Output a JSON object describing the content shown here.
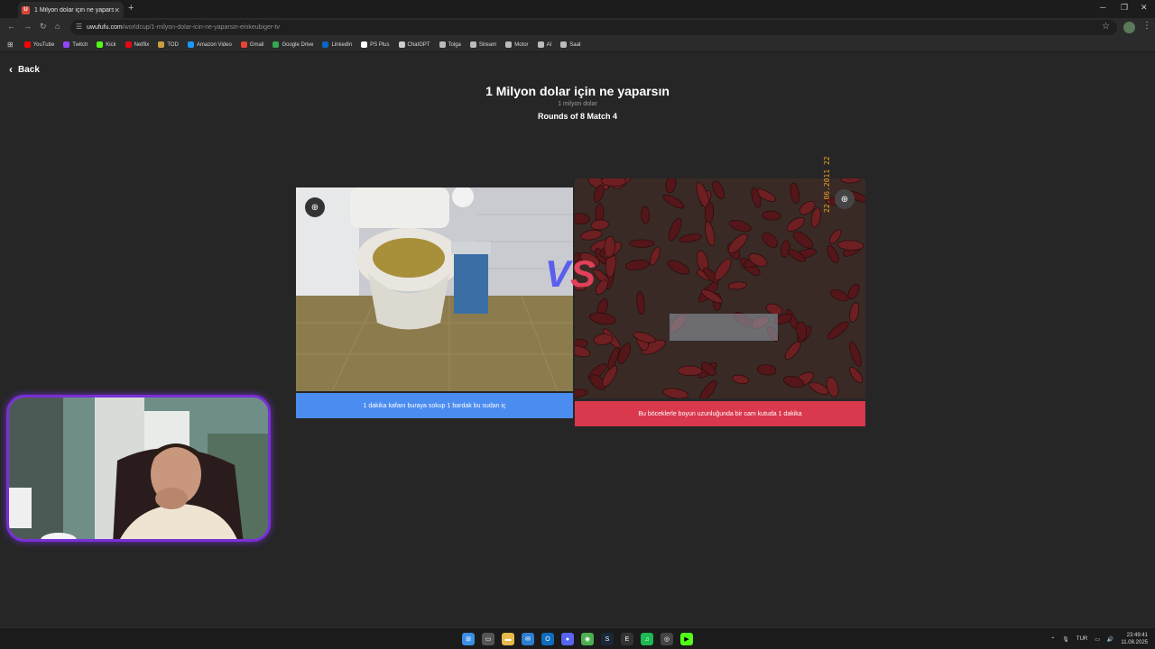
{
  "browser": {
    "tab_title": "1 Milyon dolar için ne yaparsın",
    "tab_favicon_letter": "U",
    "url_host": "uwufufu.com",
    "url_path": "/worldcup/1-milyon-dolar-icin-ne-yaparsin-einkeubiger-tv",
    "bookmarks": [
      {
        "label": "YouTube",
        "color": "#ff0000"
      },
      {
        "label": "Twitch",
        "color": "#9146ff"
      },
      {
        "label": "Kick",
        "color": "#53fc18"
      },
      {
        "label": "Netflix",
        "color": "#e50914"
      },
      {
        "label": "TOD",
        "color": "#c8a040"
      },
      {
        "label": "Amazon Video",
        "color": "#1a98ff"
      },
      {
        "label": "Gmail",
        "color": "#ea4335"
      },
      {
        "label": "Google Drive",
        "color": "#34a853"
      },
      {
        "label": "LinkedIn",
        "color": "#0a66c2"
      },
      {
        "label": "PS Plus",
        "color": "#ffffff"
      },
      {
        "label": "ChatGPT",
        "color": "#cccccc"
      },
      {
        "label": "Tolga",
        "color": "#bbbbbb"
      },
      {
        "label": "Stream",
        "color": "#bbbbbb"
      },
      {
        "label": "Motor",
        "color": "#bbbbbb"
      },
      {
        "label": "AI",
        "color": "#bbbbbb"
      },
      {
        "label": "Saat",
        "color": "#bbbbbb"
      }
    ]
  },
  "page": {
    "back_label": "Back",
    "title": "1 Milyon dolar için ne yaparsın",
    "subtitle": "1 milyon dolar",
    "rounds": "Rounds of 8 Match 4",
    "vs_v": "V",
    "vs_s": "S",
    "left_caption": "1 dakika kafanı buraya sokup 1 bardak bu sudan iç",
    "right_caption": "Bu böceklerle boyun uzunluğunda bir cam kutuda 1 dakika",
    "right_image_datestamp": "22.06.2011 22",
    "colors": {
      "left_accent": "#4b8cf0",
      "right_accent": "#d9384d"
    }
  },
  "taskbar": {
    "lang": "TUR",
    "time": "23:49:41",
    "date": "11.08.2025"
  }
}
